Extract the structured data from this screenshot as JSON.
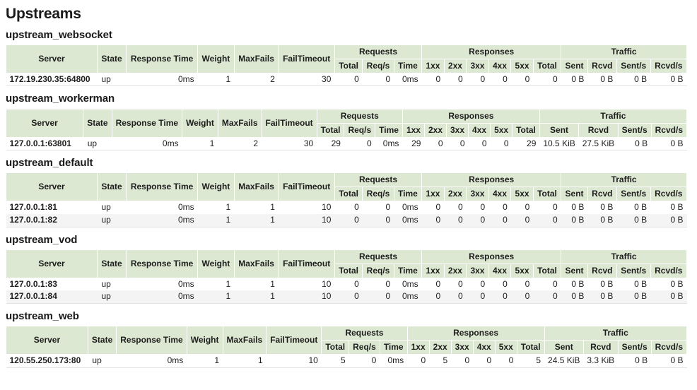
{
  "page": {
    "title": "Upstreams"
  },
  "theme": {
    "header_bg": "#dde8d2",
    "header_border": "#ffffff",
    "row_alt_bg": "#f4f4f4",
    "page_bg": "#ffffff",
    "text": "#1d1d1d"
  },
  "columns": {
    "server": "Server",
    "state": "State",
    "response_time": "Response Time",
    "weight": "Weight",
    "maxfails": "MaxFails",
    "failtimeout": "FailTimeout",
    "group_requests": "Requests",
    "group_responses": "Responses",
    "group_traffic": "Traffic",
    "req_total": "Total",
    "req_per_s": "Req/s",
    "req_time": "Time",
    "resp_1xx": "1xx",
    "resp_2xx": "2xx",
    "resp_3xx": "3xx",
    "resp_4xx": "4xx",
    "resp_5xx": "5xx",
    "resp_total": "Total",
    "traffic_sent": "Sent",
    "traffic_rcvd": "Rcvd",
    "traffic_sent_s": "Sent/s",
    "traffic_rcvd_s": "Rcvd/s"
  },
  "upstreams": [
    {
      "name": "upstream_websocket",
      "rows": [
        {
          "server": "172.19.230.35:64800",
          "state": "up",
          "response_time": "0ms",
          "weight": "1",
          "maxfails": "2",
          "failtimeout": "30",
          "req_total": "0",
          "req_per_s": "0",
          "req_time": "0ms",
          "resp_1xx": "0",
          "resp_2xx": "0",
          "resp_3xx": "0",
          "resp_4xx": "0",
          "resp_5xx": "0",
          "resp_total": "0",
          "traffic_sent": "0 B",
          "traffic_rcvd": "0 B",
          "traffic_sent_s": "0 B",
          "traffic_rcvd_s": "0 B"
        }
      ]
    },
    {
      "name": "upstream_workerman",
      "rows": [
        {
          "server": "127.0.0.1:63801",
          "state": "up",
          "response_time": "0ms",
          "weight": "1",
          "maxfails": "2",
          "failtimeout": "30",
          "req_total": "29",
          "req_per_s": "0",
          "req_time": "0ms",
          "resp_1xx": "29",
          "resp_2xx": "0",
          "resp_3xx": "0",
          "resp_4xx": "0",
          "resp_5xx": "0",
          "resp_total": "29",
          "traffic_sent": "10.5 KiB",
          "traffic_rcvd": "27.5 KiB",
          "traffic_sent_s": "0 B",
          "traffic_rcvd_s": "0 B"
        }
      ]
    },
    {
      "name": "upstream_default",
      "rows": [
        {
          "server": "127.0.0.1:81",
          "state": "up",
          "response_time": "0ms",
          "weight": "1",
          "maxfails": "1",
          "failtimeout": "10",
          "req_total": "0",
          "req_per_s": "0",
          "req_time": "0ms",
          "resp_1xx": "0",
          "resp_2xx": "0",
          "resp_3xx": "0",
          "resp_4xx": "0",
          "resp_5xx": "0",
          "resp_total": "0",
          "traffic_sent": "0 B",
          "traffic_rcvd": "0 B",
          "traffic_sent_s": "0 B",
          "traffic_rcvd_s": "0 B"
        },
        {
          "server": "127.0.0.1:82",
          "state": "up",
          "response_time": "0ms",
          "weight": "1",
          "maxfails": "1",
          "failtimeout": "10",
          "req_total": "0",
          "req_per_s": "0",
          "req_time": "0ms",
          "resp_1xx": "0",
          "resp_2xx": "0",
          "resp_3xx": "0",
          "resp_4xx": "0",
          "resp_5xx": "0",
          "resp_total": "0",
          "traffic_sent": "0 B",
          "traffic_rcvd": "0 B",
          "traffic_sent_s": "0 B",
          "traffic_rcvd_s": "0 B"
        }
      ]
    },
    {
      "name": "upstream_vod",
      "rows": [
        {
          "server": "127.0.0.1:83",
          "state": "up",
          "response_time": "0ms",
          "weight": "1",
          "maxfails": "1",
          "failtimeout": "10",
          "req_total": "0",
          "req_per_s": "0",
          "req_time": "0ms",
          "resp_1xx": "0",
          "resp_2xx": "0",
          "resp_3xx": "0",
          "resp_4xx": "0",
          "resp_5xx": "0",
          "resp_total": "0",
          "traffic_sent": "0 B",
          "traffic_rcvd": "0 B",
          "traffic_sent_s": "0 B",
          "traffic_rcvd_s": "0 B"
        },
        {
          "server": "127.0.0.1:84",
          "state": "up",
          "response_time": "0ms",
          "weight": "1",
          "maxfails": "1",
          "failtimeout": "10",
          "req_total": "0",
          "req_per_s": "0",
          "req_time": "0ms",
          "resp_1xx": "0",
          "resp_2xx": "0",
          "resp_3xx": "0",
          "resp_4xx": "0",
          "resp_5xx": "0",
          "resp_total": "0",
          "traffic_sent": "0 B",
          "traffic_rcvd": "0 B",
          "traffic_sent_s": "0 B",
          "traffic_rcvd_s": "0 B"
        }
      ]
    },
    {
      "name": "upstream_web",
      "rows": [
        {
          "server": "120.55.250.173:80",
          "state": "up",
          "response_time": "0ms",
          "weight": "1",
          "maxfails": "1",
          "failtimeout": "10",
          "req_total": "5",
          "req_per_s": "0",
          "req_time": "0ms",
          "resp_1xx": "0",
          "resp_2xx": "5",
          "resp_3xx": "0",
          "resp_4xx": "0",
          "resp_5xx": "0",
          "resp_total": "5",
          "traffic_sent": "24.5 KiB",
          "traffic_rcvd": "3.3 KiB",
          "traffic_sent_s": "0 B",
          "traffic_rcvd_s": "0 B"
        }
      ]
    }
  ]
}
